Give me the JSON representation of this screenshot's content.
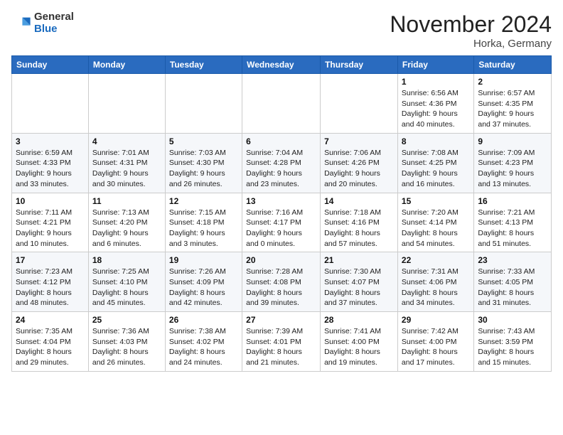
{
  "logo": {
    "general": "General",
    "blue": "Blue"
  },
  "title": "November 2024",
  "location": "Horka, Germany",
  "days_header": [
    "Sunday",
    "Monday",
    "Tuesday",
    "Wednesday",
    "Thursday",
    "Friday",
    "Saturday"
  ],
  "weeks": [
    [
      {
        "day": "",
        "info": ""
      },
      {
        "day": "",
        "info": ""
      },
      {
        "day": "",
        "info": ""
      },
      {
        "day": "",
        "info": ""
      },
      {
        "day": "",
        "info": ""
      },
      {
        "day": "1",
        "info": "Sunrise: 6:56 AM\nSunset: 4:36 PM\nDaylight: 9 hours\nand 40 minutes."
      },
      {
        "day": "2",
        "info": "Sunrise: 6:57 AM\nSunset: 4:35 PM\nDaylight: 9 hours\nand 37 minutes."
      }
    ],
    [
      {
        "day": "3",
        "info": "Sunrise: 6:59 AM\nSunset: 4:33 PM\nDaylight: 9 hours\nand 33 minutes."
      },
      {
        "day": "4",
        "info": "Sunrise: 7:01 AM\nSunset: 4:31 PM\nDaylight: 9 hours\nand 30 minutes."
      },
      {
        "day": "5",
        "info": "Sunrise: 7:03 AM\nSunset: 4:30 PM\nDaylight: 9 hours\nand 26 minutes."
      },
      {
        "day": "6",
        "info": "Sunrise: 7:04 AM\nSunset: 4:28 PM\nDaylight: 9 hours\nand 23 minutes."
      },
      {
        "day": "7",
        "info": "Sunrise: 7:06 AM\nSunset: 4:26 PM\nDaylight: 9 hours\nand 20 minutes."
      },
      {
        "day": "8",
        "info": "Sunrise: 7:08 AM\nSunset: 4:25 PM\nDaylight: 9 hours\nand 16 minutes."
      },
      {
        "day": "9",
        "info": "Sunrise: 7:09 AM\nSunset: 4:23 PM\nDaylight: 9 hours\nand 13 minutes."
      }
    ],
    [
      {
        "day": "10",
        "info": "Sunrise: 7:11 AM\nSunset: 4:21 PM\nDaylight: 9 hours\nand 10 minutes."
      },
      {
        "day": "11",
        "info": "Sunrise: 7:13 AM\nSunset: 4:20 PM\nDaylight: 9 hours\nand 6 minutes."
      },
      {
        "day": "12",
        "info": "Sunrise: 7:15 AM\nSunset: 4:18 PM\nDaylight: 9 hours\nand 3 minutes."
      },
      {
        "day": "13",
        "info": "Sunrise: 7:16 AM\nSunset: 4:17 PM\nDaylight: 9 hours\nand 0 minutes."
      },
      {
        "day": "14",
        "info": "Sunrise: 7:18 AM\nSunset: 4:16 PM\nDaylight: 8 hours\nand 57 minutes."
      },
      {
        "day": "15",
        "info": "Sunrise: 7:20 AM\nSunset: 4:14 PM\nDaylight: 8 hours\nand 54 minutes."
      },
      {
        "day": "16",
        "info": "Sunrise: 7:21 AM\nSunset: 4:13 PM\nDaylight: 8 hours\nand 51 minutes."
      }
    ],
    [
      {
        "day": "17",
        "info": "Sunrise: 7:23 AM\nSunset: 4:12 PM\nDaylight: 8 hours\nand 48 minutes."
      },
      {
        "day": "18",
        "info": "Sunrise: 7:25 AM\nSunset: 4:10 PM\nDaylight: 8 hours\nand 45 minutes."
      },
      {
        "day": "19",
        "info": "Sunrise: 7:26 AM\nSunset: 4:09 PM\nDaylight: 8 hours\nand 42 minutes."
      },
      {
        "day": "20",
        "info": "Sunrise: 7:28 AM\nSunset: 4:08 PM\nDaylight: 8 hours\nand 39 minutes."
      },
      {
        "day": "21",
        "info": "Sunrise: 7:30 AM\nSunset: 4:07 PM\nDaylight: 8 hours\nand 37 minutes."
      },
      {
        "day": "22",
        "info": "Sunrise: 7:31 AM\nSunset: 4:06 PM\nDaylight: 8 hours\nand 34 minutes."
      },
      {
        "day": "23",
        "info": "Sunrise: 7:33 AM\nSunset: 4:05 PM\nDaylight: 8 hours\nand 31 minutes."
      }
    ],
    [
      {
        "day": "24",
        "info": "Sunrise: 7:35 AM\nSunset: 4:04 PM\nDaylight: 8 hours\nand 29 minutes."
      },
      {
        "day": "25",
        "info": "Sunrise: 7:36 AM\nSunset: 4:03 PM\nDaylight: 8 hours\nand 26 minutes."
      },
      {
        "day": "26",
        "info": "Sunrise: 7:38 AM\nSunset: 4:02 PM\nDaylight: 8 hours\nand 24 minutes."
      },
      {
        "day": "27",
        "info": "Sunrise: 7:39 AM\nSunset: 4:01 PM\nDaylight: 8 hours\nand 21 minutes."
      },
      {
        "day": "28",
        "info": "Sunrise: 7:41 AM\nSunset: 4:00 PM\nDaylight: 8 hours\nand 19 minutes."
      },
      {
        "day": "29",
        "info": "Sunrise: 7:42 AM\nSunset: 4:00 PM\nDaylight: 8 hours\nand 17 minutes."
      },
      {
        "day": "30",
        "info": "Sunrise: 7:43 AM\nSunset: 3:59 PM\nDaylight: 8 hours\nand 15 minutes."
      }
    ]
  ]
}
